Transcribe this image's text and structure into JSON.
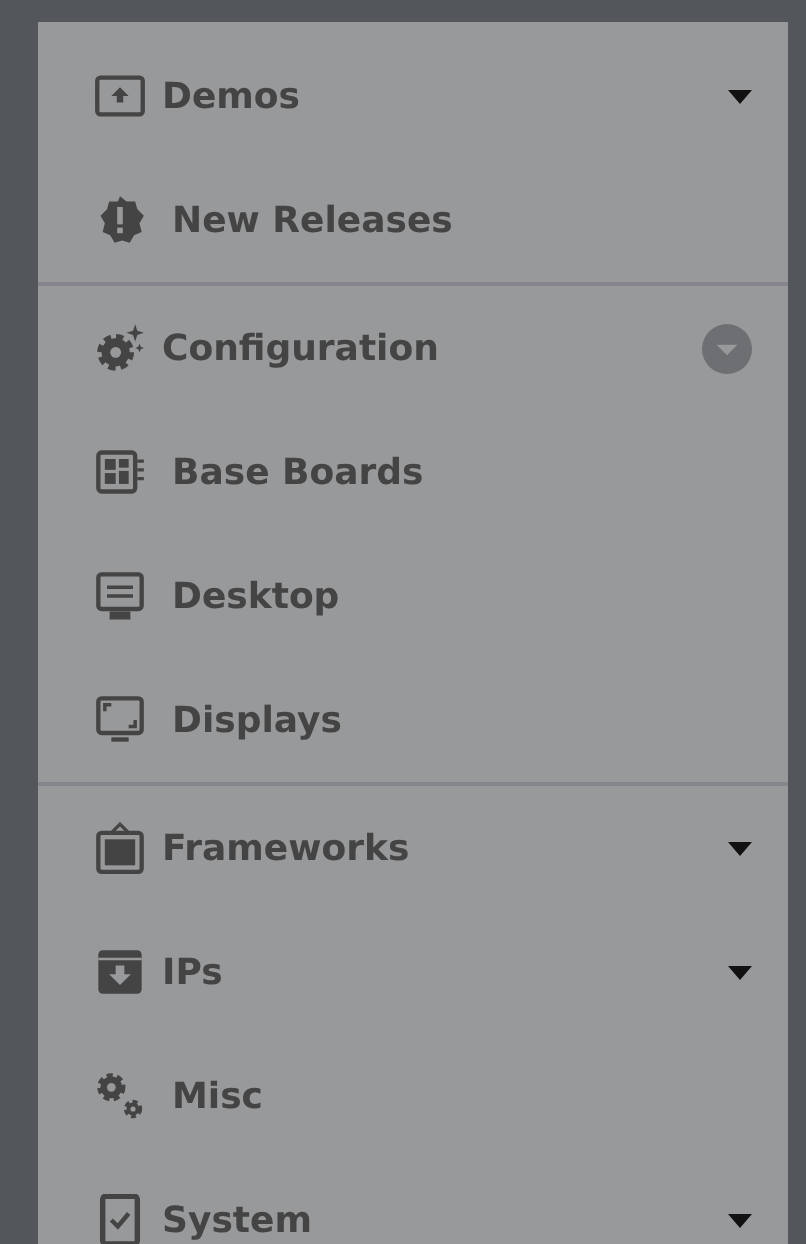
{
  "sections": [
    {
      "items": [
        {
          "kind": "menu",
          "label": "Demos",
          "expanded": false
        },
        {
          "kind": "link",
          "label": "New Releases"
        }
      ]
    },
    {
      "items": [
        {
          "kind": "menu",
          "label": "Configuration",
          "expanded": true,
          "children": [
            {
              "label": "Base Boards"
            },
            {
              "label": "Desktop"
            },
            {
              "label": "Displays"
            }
          ]
        }
      ]
    },
    {
      "items": [
        {
          "kind": "menu",
          "label": "Frameworks",
          "expanded": false
        },
        {
          "kind": "menu",
          "label": "IPs",
          "expanded": false
        },
        {
          "kind": "link",
          "label": "Misc"
        },
        {
          "kind": "menu",
          "label": "System",
          "expanded": false
        }
      ]
    }
  ]
}
